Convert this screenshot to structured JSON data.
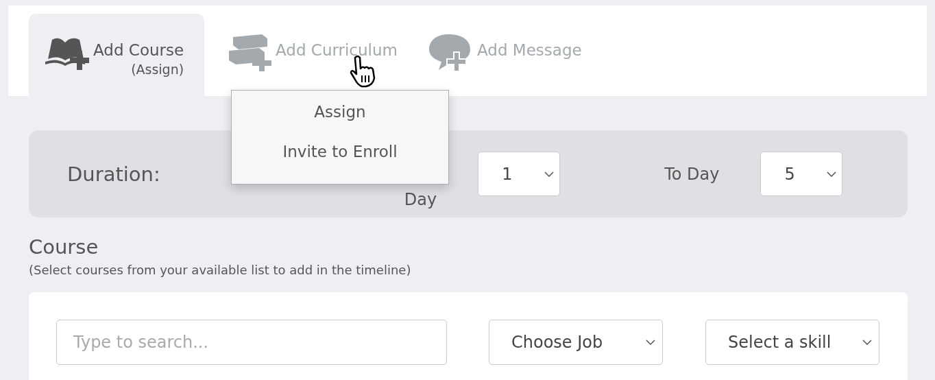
{
  "tabs": [
    {
      "kind": "open-book",
      "label": "Add Course",
      "sublabel": "(Assign)",
      "selected": true
    },
    {
      "kind": "books",
      "label": "Add Curriculum",
      "selected": false
    },
    {
      "kind": "speech",
      "label": "Add Message",
      "selected": false
    }
  ],
  "tab_menu": {
    "items": [
      "Assign",
      "Invite to Enroll"
    ]
  },
  "duration": {
    "label": "Duration:",
    "from_label": "Day",
    "from_value": "1",
    "to_label": "To Day",
    "to_value": "5"
  },
  "course": {
    "title": "Course",
    "subtitle": "(Select courses from your available list to add in the timeline)",
    "search": {
      "placeholder": "Type to search..."
    },
    "job": "Choose Job",
    "skill": "Select a skill"
  }
}
